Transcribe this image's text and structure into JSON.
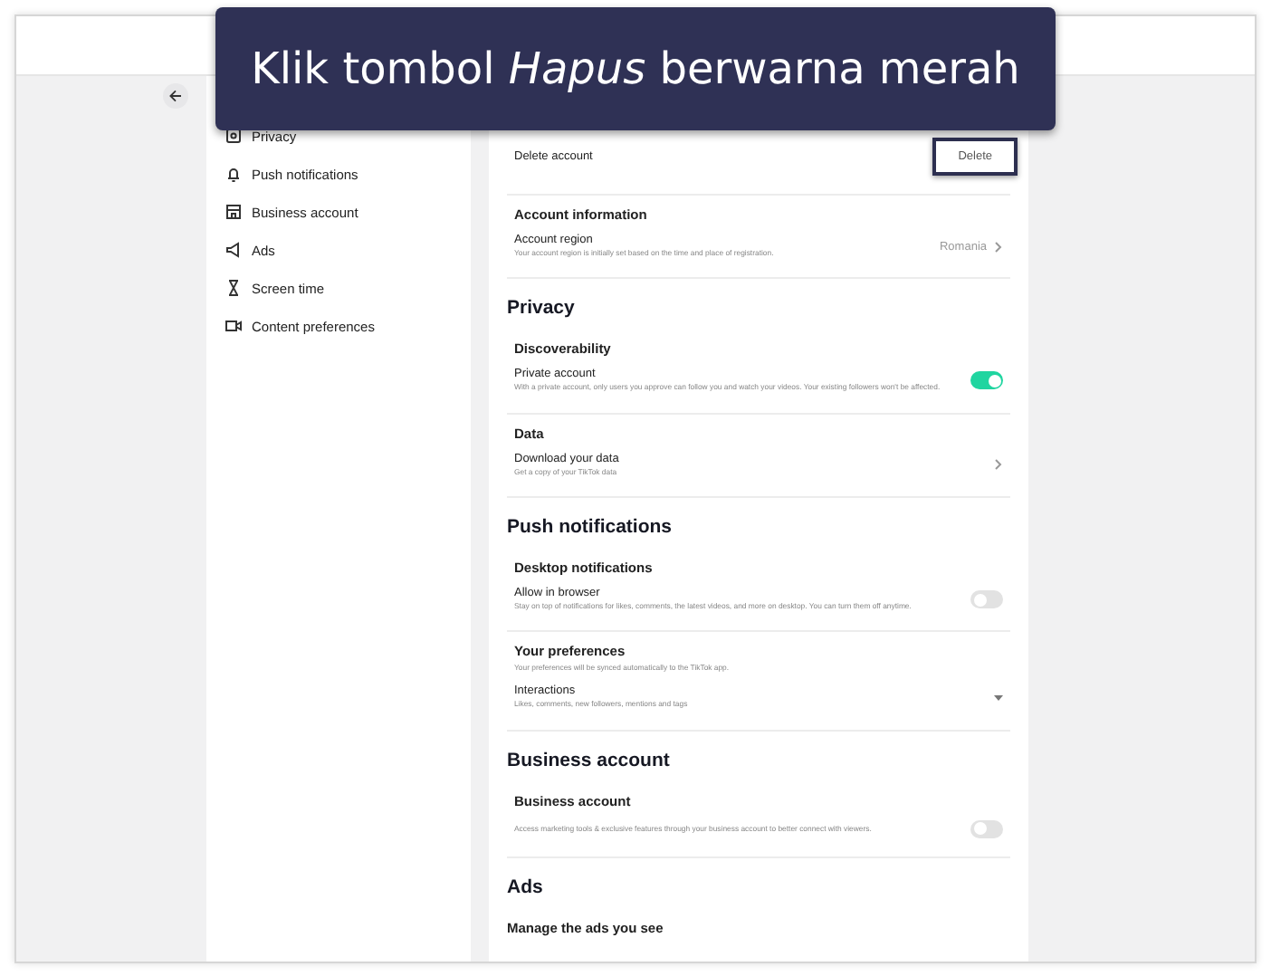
{
  "callout": {
    "text": "Klik tombol *Hapus* berwarna merah"
  },
  "sidebar": {
    "items": [
      {
        "label": "Privacy"
      },
      {
        "label": "Push notifications"
      },
      {
        "label": "Business account"
      },
      {
        "label": "Ads"
      },
      {
        "label": "Screen time"
      },
      {
        "label": "Content preferences"
      }
    ]
  },
  "sections": [
    {
      "groups": [
        {
          "rows": [
            {
              "kind": "button",
              "label": "Delete account",
              "action": "Delete",
              "highlighted": true
            }
          ]
        },
        {
          "heading": "Account information",
          "rows": [
            {
              "kind": "link",
              "label": "Account region",
              "description": "Your account region is initially set based on the time and place of registration.",
              "value": "Romania"
            }
          ]
        }
      ]
    },
    {
      "title": "Privacy",
      "groups": [
        {
          "heading": "Discoverability",
          "rows": [
            {
              "kind": "toggle",
              "label": "Private account",
              "description": "With a private account, only users you approve can follow you and watch your videos. Your existing followers won't be affected.",
              "on": true
            }
          ]
        },
        {
          "heading": "Data",
          "rows": [
            {
              "kind": "link",
              "label": "Download your data",
              "description": "Get a copy of your TikTok data"
            }
          ]
        }
      ]
    },
    {
      "title": "Push notifications",
      "groups": [
        {
          "heading": "Desktop notifications",
          "rows": [
            {
              "kind": "toggle",
              "label": "Allow in browser",
              "description": "Stay on top of notifications for likes, comments, the latest videos, and more on desktop. You can turn them off anytime.",
              "on": false
            }
          ]
        },
        {
          "heading": "Your preferences",
          "description": "Your preferences will be synced automatically to the TikTok app.",
          "rows": [
            {
              "kind": "dropdown",
              "label": "Interactions",
              "description": "Likes, comments, new followers, mentions and tags"
            }
          ]
        }
      ]
    },
    {
      "title": "Business account",
      "groups": [
        {
          "heading": "Business account",
          "rows": [
            {
              "kind": "toggle",
              "description": "Access marketing tools & exclusive features through your business account to better connect with viewers.",
              "on": false
            }
          ]
        }
      ]
    },
    {
      "title": "Ads",
      "groups": [
        {
          "heading": "Manage the ads you see"
        }
      ]
    }
  ]
}
